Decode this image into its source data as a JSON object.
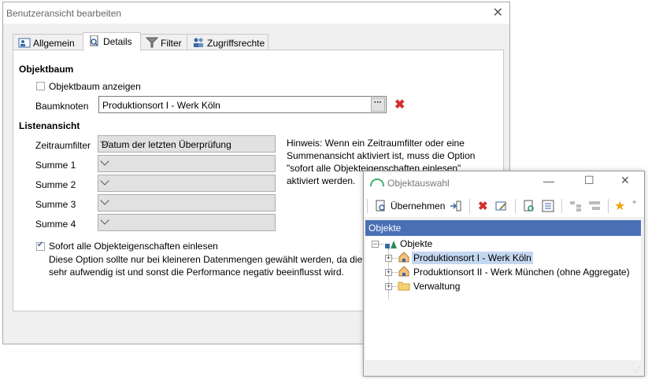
{
  "dialog": {
    "title": "Benutzeransicht bearbeiten",
    "close_icon": "close-icon",
    "tabs": [
      {
        "label": "Allgemein",
        "icon": "person-card-icon"
      },
      {
        "label": "Details",
        "icon": "document-search-icon"
      },
      {
        "label": "Filter",
        "icon": "funnel-icon"
      },
      {
        "label": "Zugriffsrechte",
        "icon": "users-icon"
      }
    ],
    "active_tab": "Details",
    "objektbaum": {
      "heading": "Objektbaum",
      "show_tree_label": "Objektbaum anzeigen",
      "show_tree_checked": false,
      "node_label": "Baumknoten",
      "node_value": "Produktionsort I - Werk Köln",
      "browse_label": "···"
    },
    "listenansicht": {
      "heading": "Listenansicht",
      "zeitraum_label": "Zeitraumfilter",
      "zeitraum_value": "Datum der letzten Überprüfung",
      "sum_labels": [
        "Summe 1",
        "Summe 2",
        "Summe 3",
        "Summe 4"
      ],
      "hint": "Hinweis: Wenn ein Zeitraumfilter oder eine Summenansicht aktiviert ist, muss die Option \"sofort alle Objekteigenschaften einlesen\" aktiviert werden."
    },
    "sofort": {
      "label": "Sofort alle Objekteigenschaften einlesen",
      "checked": true,
      "note_line1": "Diese Option sollte nur bei kleineren Datenmengen gewählt werden, da die D",
      "note_line2": "sehr aufwendig ist und sonst die Performance negativ beeinflusst wird."
    }
  },
  "picker": {
    "title": "Objektauswahl",
    "apply_label": "Übernehmen",
    "header": "Objekte",
    "tree": [
      {
        "label": "Objekte",
        "icon": "objects-root-icon"
      },
      {
        "label": "Produktionsort I - Werk Köln",
        "icon": "house-icon",
        "selected": true
      },
      {
        "label": "Produktionsort II - Werk München (ohne Aggregate)",
        "icon": "house-icon"
      },
      {
        "label": "Verwaltung",
        "icon": "folder-icon"
      }
    ]
  },
  "colors": {
    "accent": "#4a6fb5",
    "selection": "#c4d7f0",
    "delete": "#d32f2f"
  }
}
